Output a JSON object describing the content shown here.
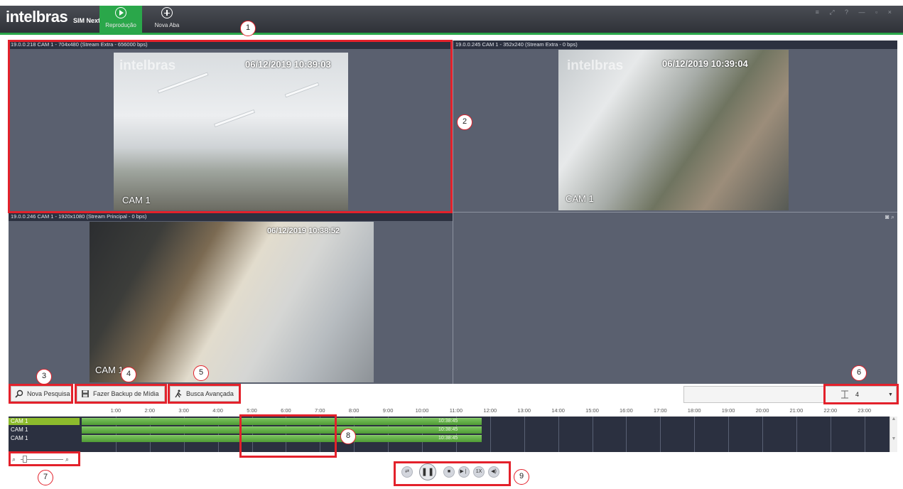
{
  "header": {
    "logo": "intelbras",
    "product": "SIM Next",
    "tabs": [
      {
        "label": "Reprodução",
        "icon": "play-circle-icon"
      },
      {
        "label": "Nova Aba",
        "icon": "plus-circle-icon"
      }
    ],
    "window_controls": "≡ ⤢ ? — ▫ ×"
  },
  "panes": [
    {
      "header": "19.0.0.218 CAM 1 - 704x480 (Stream Extra - 656000 bps)",
      "timestamp": "06/12/2019 10:39:03",
      "camera_label": "CAM 1",
      "watermark": "intelbras"
    },
    {
      "header": "19.0.0.245 CAM 1 - 352x240 (Stream Extra - 0 bps)",
      "timestamp": "06/12/2019 10:39:04",
      "camera_label": "CAM 1",
      "watermark": "intelbras"
    },
    {
      "header": "19.0.0.246 CAM 1 - 1920x1080 (Stream Principal - 0 bps)",
      "timestamp": "06/12/2019 10:38:52",
      "camera_label": "CAM 1"
    }
  ],
  "toolbar": {
    "nova_pesquisa": "Nova Pesquisa",
    "backup": "Fazer Backup de Mídia",
    "busca": "Busca Avançada",
    "layout_value": "4"
  },
  "timeline": {
    "ticks": [
      "1:00",
      "2:00",
      "3:00",
      "4:00",
      "5:00",
      "6:00",
      "7:00",
      "8:00",
      "9:00",
      "10:00",
      "11:00",
      "12:00",
      "13:00",
      "14:00",
      "15:00",
      "16:00",
      "17:00",
      "18:00",
      "19:00",
      "20:00",
      "21:00",
      "22:00",
      "23:00"
    ],
    "rows": [
      {
        "label": "CAM 1",
        "time": "10:38:45"
      },
      {
        "label": "CAM 1",
        "time": "10:38:45"
      },
      {
        "label": "CAM 1",
        "time": "10:38:45"
      }
    ]
  },
  "playback": {
    "speed": "1X"
  },
  "annotations": [
    "1",
    "2",
    "3",
    "4",
    "5",
    "6",
    "7",
    "8",
    "9"
  ],
  "colors": {
    "accent": "#2aa74a",
    "highlight": "#e3212b",
    "timeline_bg": "#2b3040",
    "recording_bar": "#5aa83e"
  }
}
